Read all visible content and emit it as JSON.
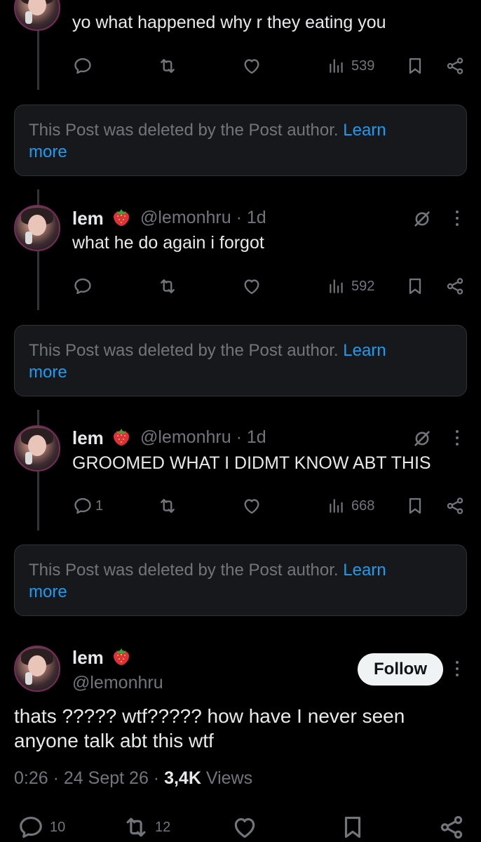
{
  "top_reply": {
    "text": "yo what happened why r they eating you",
    "views": "539"
  },
  "deleted_notice": {
    "text": "This Post was deleted by the Post author.",
    "learn_more": "Learn more",
    "learn": "Learn",
    "more": "more"
  },
  "reply_1": {
    "name": "lem",
    "handle": "@lemonhru",
    "time": "· 1d",
    "text": "what he do again i forgot",
    "views": "592"
  },
  "reply_2": {
    "name": "lem",
    "handle": "@lemonhru",
    "time": "· 1d",
    "text": "GROOMED WHAT I DIDMT KNOW ABT THIS",
    "replies": "1",
    "views": "668"
  },
  "main_post": {
    "name": "lem",
    "handle": "@lemonhru",
    "follow_label": "Follow",
    "text_line1": "thats ????? wtf????? how have I never seen",
    "text_line2": "anyone talk abt this wtf",
    "time": "0:26",
    "date": "24 Sept 26",
    "views_count": "3,4K",
    "views_label": "Views",
    "replies": "10",
    "reposts": "12"
  },
  "icons": {
    "reply": "reply-icon",
    "repost": "repost-icon",
    "like": "heart-icon",
    "views": "views-icon",
    "bookmark": "bookmark-icon",
    "share": "share-icon",
    "grok": "grok-icon",
    "more": "more-icon",
    "emoji": "strawberry-emoji"
  },
  "colors": {
    "background": "#000000",
    "text": "#e7e9ea",
    "muted": "#71767b",
    "link": "#1d9bf0",
    "card": "#16181c"
  }
}
